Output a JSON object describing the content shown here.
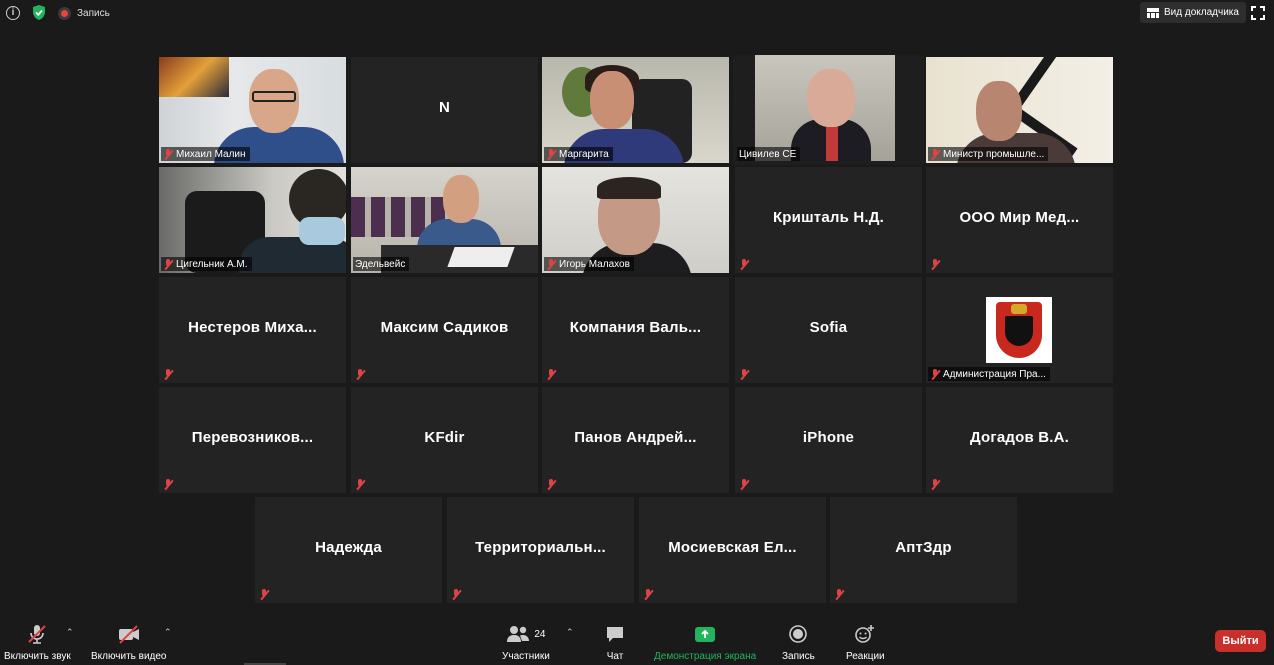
{
  "topbar": {
    "info_icon": "info-icon",
    "security_icon": "shield-check-icon",
    "recording_label": "Запись",
    "view_label": "Вид докладчика",
    "fullscreen_icon": "fullscreen-icon"
  },
  "tiles": [
    {
      "name": "Михаил Малин",
      "type": "video",
      "muted": true
    },
    {
      "name": "N",
      "type": "name",
      "muted": true
    },
    {
      "name": "Маргарита",
      "type": "video",
      "muted": true
    },
    {
      "name": "Цивилев СЕ",
      "type": "video",
      "muted": false,
      "active": true
    },
    {
      "name": "Министр промышле...",
      "type": "video",
      "muted": true
    },
    {
      "name": "Цигельник А.М.",
      "type": "video",
      "muted": true
    },
    {
      "name": "Эдельвейс",
      "type": "video",
      "muted": false
    },
    {
      "name": "Игорь Малахов",
      "type": "video",
      "muted": true
    },
    {
      "name": "Кришталь Н.Д.",
      "type": "name",
      "muted": true
    },
    {
      "name": "ООО Мир Мед...",
      "type": "name",
      "muted": true
    },
    {
      "name": "Нестеров Миха...",
      "type": "name",
      "muted": true
    },
    {
      "name": "Максим Садиков",
      "type": "name",
      "muted": true
    },
    {
      "name": "Компания Валь...",
      "type": "name",
      "muted": true
    },
    {
      "name": "Sofia",
      "type": "name",
      "muted": true
    },
    {
      "name": "Администрация Пра...",
      "type": "logo",
      "muted": true
    },
    {
      "name": "Перевозников...",
      "type": "name",
      "muted": true
    },
    {
      "name": "KFdir",
      "type": "name",
      "muted": true
    },
    {
      "name": "Панов Андрей...",
      "type": "name",
      "muted": true
    },
    {
      "name": "iPhone",
      "type": "name",
      "muted": true
    },
    {
      "name": "Догадов В.А.",
      "type": "name",
      "muted": true
    },
    {
      "name": "Надежда",
      "type": "name",
      "muted": true
    },
    {
      "name": "Территориальн...",
      "type": "name",
      "muted": true
    },
    {
      "name": "Мосиевская Ел...",
      "type": "name",
      "muted": true
    },
    {
      "name": "АптЗдр",
      "type": "name",
      "muted": true
    }
  ],
  "toolbar": {
    "audio_label": "Включить звук",
    "video_label": "Включить видео",
    "participants_label": "Участники",
    "participants_count": "24",
    "chat_label": "Чат",
    "share_label": "Демонстрация экрана",
    "record_label": "Запись",
    "reactions_label": "Реакции",
    "leave_label": "Выйти"
  },
  "colors": {
    "background": "#1a1a1a",
    "tile": "#232323",
    "active_speaker": "#c5e46b",
    "muted": "#e04343",
    "share": "#23b35d",
    "leave": "#c9302c"
  }
}
